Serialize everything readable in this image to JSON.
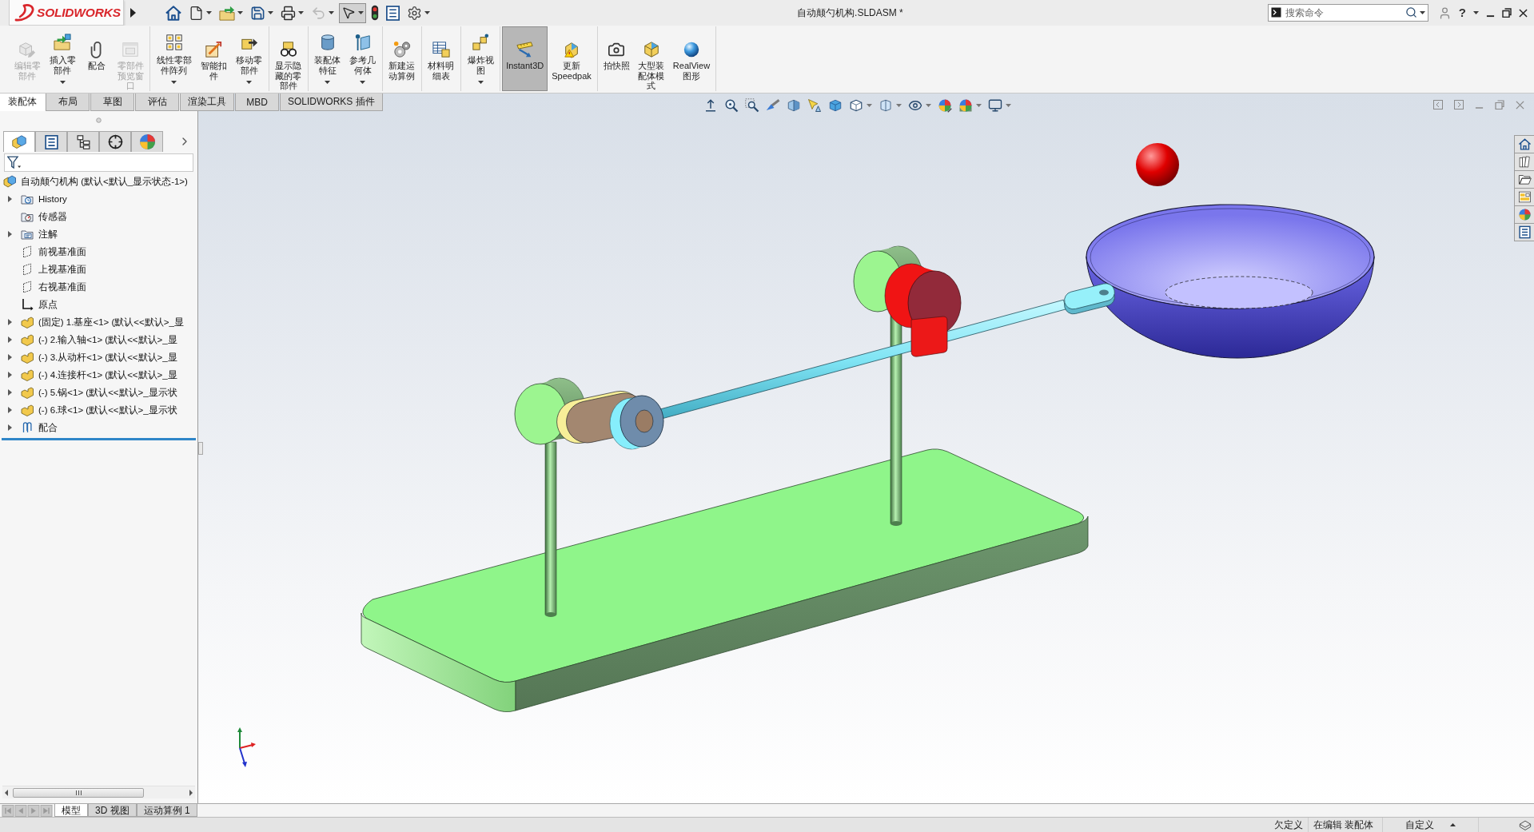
{
  "title_bar": {
    "logo": "SOLIDWORKS",
    "quick_access": [
      {
        "kind": "home",
        "dropdown": false,
        "disabled": false,
        "pressed": false
      },
      {
        "kind": "new",
        "dropdown": true,
        "disabled": false,
        "pressed": false
      },
      {
        "kind": "open",
        "dropdown": true,
        "disabled": false,
        "pressed": false
      },
      {
        "kind": "save",
        "dropdown": true,
        "disabled": false,
        "pressed": false
      },
      {
        "kind": "print",
        "dropdown": true,
        "disabled": false,
        "pressed": false
      },
      {
        "kind": "undo",
        "dropdown": true,
        "disabled": true,
        "pressed": false
      },
      {
        "kind": "select",
        "dropdown": true,
        "disabled": false,
        "pressed": true
      },
      {
        "kind": "rebuild",
        "dropdown": false,
        "disabled": false,
        "pressed": false
      },
      {
        "kind": "properties",
        "dropdown": false,
        "disabled": false,
        "pressed": false
      },
      {
        "kind": "options",
        "dropdown": true,
        "disabled": false,
        "pressed": false
      }
    ],
    "title": "自动颠勺机构.SLDASM *",
    "search": {
      "placeholder": "搜索命令"
    },
    "help": "?"
  },
  "ribbon": {
    "groups": [
      [
        {
          "label": "编辑零部件",
          "kind": "edit-part",
          "dropdown": false,
          "disabled": true,
          "pressed": false
        },
        {
          "label": "插入零部件",
          "kind": "insert-part",
          "dropdown": true,
          "disabled": false,
          "pressed": false
        },
        {
          "label": "配合",
          "kind": "mate",
          "dropdown": false,
          "disabled": false,
          "pressed": false
        },
        {
          "label": "零部件预览窗口",
          "kind": "preview-window",
          "dropdown": false,
          "disabled": true,
          "pressed": false
        }
      ],
      [
        {
          "label": "线性零部件阵列",
          "kind": "linear-pattern",
          "dropdown": true,
          "disabled": false,
          "pressed": false
        },
        {
          "label": "智能扣件",
          "kind": "smart-fastener",
          "dropdown": false,
          "disabled": false,
          "pressed": false
        },
        {
          "label": "移动零部件",
          "kind": "move-part",
          "dropdown": true,
          "disabled": false,
          "pressed": false
        }
      ],
      [
        {
          "label": "显示隐藏的零部件",
          "kind": "show-hidden",
          "dropdown": false,
          "disabled": false,
          "pressed": false
        }
      ],
      [
        {
          "label": "装配体特征",
          "kind": "assembly-feature",
          "dropdown": true,
          "disabled": false,
          "pressed": false
        },
        {
          "label": "参考几何体",
          "kind": "reference-geometry",
          "dropdown": true,
          "disabled": false,
          "pressed": false
        }
      ],
      [
        {
          "label": "新建运动算例",
          "kind": "motion-study",
          "dropdown": false,
          "disabled": false,
          "pressed": false
        }
      ],
      [
        {
          "label": "材料明细表",
          "kind": "bom",
          "dropdown": false,
          "disabled": false,
          "pressed": false
        }
      ],
      [
        {
          "label": "爆炸视图",
          "kind": "exploded-view",
          "dropdown": true,
          "disabled": false,
          "pressed": false
        }
      ],
      [
        {
          "label": "Instant3D",
          "kind": "instant3d",
          "dropdown": false,
          "disabled": false,
          "pressed": true
        },
        {
          "label": "更新Speedpak",
          "kind": "speedpak",
          "dropdown": false,
          "disabled": false,
          "pressed": false
        }
      ],
      [
        {
          "label": "拍快照",
          "kind": "snapshot",
          "dropdown": false,
          "disabled": false,
          "pressed": false
        },
        {
          "label": "大型装配体模式",
          "kind": "large-assembly",
          "dropdown": false,
          "disabled": false,
          "pressed": false
        },
        {
          "label": "RealView图形",
          "kind": "realview",
          "dropdown": false,
          "disabled": false,
          "pressed": false
        }
      ]
    ]
  },
  "command_tabs": [
    {
      "label": "装配体",
      "selected": true
    },
    {
      "label": "布局",
      "selected": false
    },
    {
      "label": "草图",
      "selected": false
    },
    {
      "label": "评估",
      "selected": false
    },
    {
      "label": "渲染工具",
      "selected": false
    },
    {
      "label": "MBD",
      "selected": false
    },
    {
      "label": "SOLIDWORKS 插件",
      "selected": false
    }
  ],
  "feature_manager": {
    "panel_tabs": [
      {
        "kind": "feature-tree",
        "selected": true
      },
      {
        "kind": "property-manager",
        "selected": false
      },
      {
        "kind": "configuration-manager",
        "selected": false
      },
      {
        "kind": "dimxpert-manager",
        "selected": false
      },
      {
        "kind": "display-manager",
        "selected": false
      }
    ],
    "tree": {
      "label": "自动颠勺机构 (默认<默认_显示状态-1>)",
      "kind": "assembly",
      "children": [
        {
          "label": "History",
          "kind": "history",
          "expanded": false
        },
        {
          "label": "传感器",
          "kind": "sensors"
        },
        {
          "label": "注解",
          "kind": "annotations",
          "expanded": false
        },
        {
          "label": "前视基准面",
          "kind": "plane"
        },
        {
          "label": "上视基准面",
          "kind": "plane"
        },
        {
          "label": "右视基准面",
          "kind": "plane"
        },
        {
          "label": "原点",
          "kind": "origin"
        },
        {
          "label": "(固定) 1.基座<1> (默认<<默认>_显",
          "kind": "part",
          "expanded": false
        },
        {
          "label": "(-) 2.输入轴<1> (默认<<默认>_显",
          "kind": "part",
          "expanded": false
        },
        {
          "label": "(-) 3.从动杆<1> (默认<<默认>_显",
          "kind": "part",
          "expanded": false
        },
        {
          "label": "(-) 4.连接杆<1> (默认<<默认>_显",
          "kind": "part",
          "expanded": false
        },
        {
          "label": "(-) 5.锅<1> (默认<<默认>_显示状",
          "kind": "part",
          "expanded": false
        },
        {
          "label": "(-) 6.球<1> (默认<<默认>_显示状",
          "kind": "part",
          "expanded": false
        },
        {
          "label": "配合",
          "kind": "mates",
          "expanded": false
        }
      ]
    }
  },
  "bottom_tabs": [
    {
      "label": "模型",
      "selected": true
    },
    {
      "label": "3D 视图",
      "selected": false
    },
    {
      "label": "运动算例 1",
      "selected": false
    }
  ],
  "status_bar": {
    "items": [
      "欠定义",
      "在编辑 装配体",
      "自定义"
    ]
  }
}
